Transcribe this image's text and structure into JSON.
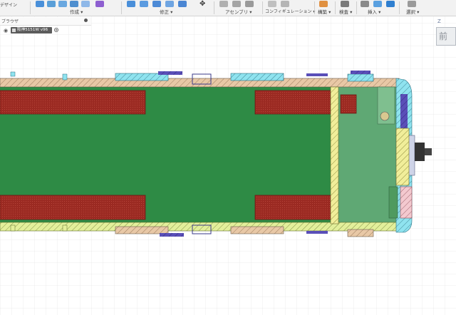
{
  "toolbar": {
    "groups": [
      {
        "id": "create",
        "label": "作成 ▾"
      },
      {
        "id": "modify",
        "label": "修正 ▾"
      },
      {
        "id": "assemble",
        "label": "アセンブリ ▾"
      },
      {
        "id": "configure",
        "label": "コンフィギュレーション ▾"
      },
      {
        "id": "construct",
        "label": "構築 ▾"
      },
      {
        "id": "inspect",
        "label": "検査 ▾"
      },
      {
        "id": "insert",
        "label": "挿入 ▾"
      },
      {
        "id": "select",
        "label": "選択 ▾"
      }
    ],
    "left_label": "デザイン"
  },
  "browser": {
    "title": "ブラウザ",
    "document_label": "阪神5151W v96"
  },
  "viewcube": {
    "face_label": "前",
    "axis_label": "Z"
  },
  "colors": {
    "floor": "#2e8b45",
    "seat": "#9b2a22",
    "wall_tan": "#e8c8a6",
    "wall_yellow_green": "#e3ef9b",
    "wall_cyan": "#8fe3ef",
    "wall_purple": "#5a4fb8",
    "cab_floor": "#5fa874",
    "grid": "#e6e6e6",
    "background": "#ffffff"
  }
}
